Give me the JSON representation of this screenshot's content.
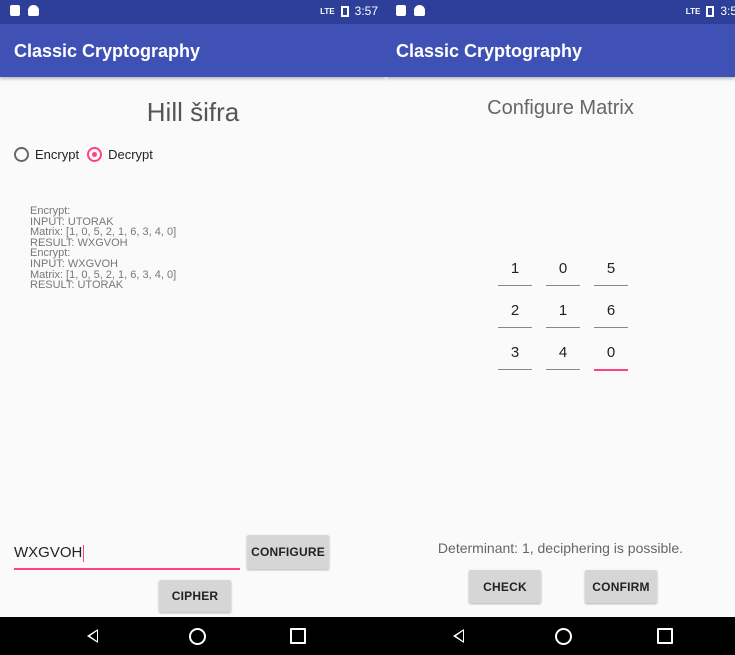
{
  "left": {
    "status": {
      "time": "3:57",
      "network": "LTE"
    },
    "app_title": "Classic Cryptography",
    "heading": "Hill šifra",
    "radio": {
      "encrypt_label": "Encrypt",
      "decrypt_label": "Decrypt",
      "selected": "Decrypt"
    },
    "log": [
      "Encrypt:",
      "INPUT: UTORAK",
      "Matrix: [1, 0, 5, 2, 1, 6, 3, 4, 0]",
      "RESULT: WXGVOH",
      "Encrypt:",
      "INPUT: WXGVOH",
      "Matrix: [1, 0, 5, 2, 1, 6, 3, 4, 0]",
      "RESULT: UTORAK"
    ],
    "input_value": "WXGVOH",
    "configure_label": "CONFIGURE",
    "cipher_label": "CIPHER"
  },
  "right": {
    "status": {
      "time": "3:5",
      "network": "LTE"
    },
    "app_title": "Classic Cryptography",
    "heading": "Configure Matrix",
    "matrix": [
      [
        "1",
        "0",
        "5"
      ],
      [
        "2",
        "1",
        "6"
      ],
      [
        "3",
        "4",
        "0"
      ]
    ],
    "determinant_text": "Determinant: 1, deciphering is possible.",
    "check_label": "CHECK",
    "confirm_label": "CONFIRM"
  },
  "colors": {
    "primary": "#3f51b5",
    "primary_dark": "#2e3f9a",
    "accent": "#ff4081"
  },
  "icons": {
    "nav": [
      "back-icon",
      "home-icon",
      "recents-icon"
    ]
  }
}
